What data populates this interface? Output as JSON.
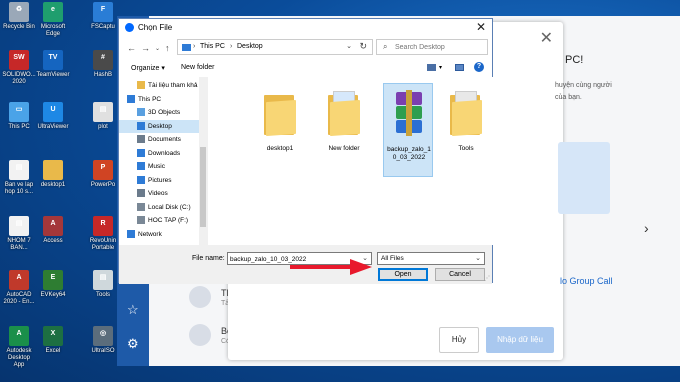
{
  "desktop_icons": [
    {
      "label": "Recycle Bin",
      "color": "#9aa8b8",
      "glyph": "♻"
    },
    {
      "label": "Microsoft Edge",
      "color": "#1f9e6e",
      "glyph": "e"
    },
    {
      "label": "FSCaptu",
      "color": "#2a7dd6",
      "glyph": "F"
    },
    {
      "label": "SOLIDWO... 2020",
      "color": "#c62828",
      "glyph": "SW"
    },
    {
      "label": "TeamViewer",
      "color": "#1565c0",
      "glyph": "TV"
    },
    {
      "label": "HashB",
      "color": "#4a4a4a",
      "glyph": "#"
    },
    {
      "label": "This PC",
      "color": "#4aa3e8",
      "glyph": "▭"
    },
    {
      "label": "UltraViewer",
      "color": "#1e88e5",
      "glyph": "U"
    },
    {
      "label": "plot",
      "color": "#e0e0e0",
      "glyph": "▤"
    },
    {
      "label": "Ban ve lap hop 10 s...",
      "color": "#f2f2f2",
      "glyph": "▤"
    },
    {
      "label": "desktop1",
      "color": "#e9b94a",
      "glyph": ""
    },
    {
      "label": "PowerPo",
      "color": "#d04423",
      "glyph": "P"
    },
    {
      "label": "NHOM 7 BAN...",
      "color": "#f2f2f2",
      "glyph": "▤"
    },
    {
      "label": "Access",
      "color": "#a4373a",
      "glyph": "A"
    },
    {
      "label": "RevoUnin Portable",
      "color": "#c62828",
      "glyph": "R"
    },
    {
      "label": "AutoCAD 2020 - En...",
      "color": "#c0392b",
      "glyph": "A"
    },
    {
      "label": "EVKey64",
      "color": "#2e7d32",
      "glyph": "E"
    },
    {
      "label": "Tools",
      "color": "#cfd8dc",
      "glyph": "▤"
    },
    {
      "label": "Autodesk Desktop App",
      "color": "#1a8f4a",
      "glyph": "A"
    },
    {
      "label": "Excel",
      "color": "#1d6f42",
      "glyph": "X"
    },
    {
      "label": "UltraISO",
      "color": "#5b6d7c",
      "glyph": "◎"
    }
  ],
  "zalo": {
    "rows": [
      {
        "title": "TB - Lớp",
        "sub": "Tấn Dũng"
      },
      {
        "title": "Bộ Y tế",
        "sub": "Có cần đi"
      }
    ],
    "right_texts": {
      "pc": "PC!",
      "desc1": "huyện cùng người",
      "desc2": "của bạn.",
      "group_call": "lo Group Call"
    },
    "cancel_label": "Hủy",
    "import_label": "Nhập dữ liệu"
  },
  "dialog": {
    "title": "Chọn File",
    "address": [
      "This PC",
      "Desktop"
    ],
    "search_placeholder": "Search Desktop",
    "organize_label": "Organize ▾",
    "new_folder_label": "New folder",
    "tree": [
      {
        "label": "Tài liệu tham khả",
        "indent": 1,
        "icon": "folder"
      },
      {
        "label": "This PC",
        "indent": 0,
        "icon": "pc"
      },
      {
        "label": "3D Objects",
        "indent": 1,
        "icon": "3d"
      },
      {
        "label": "Desktop",
        "indent": 1,
        "icon": "desktop",
        "selected": true
      },
      {
        "label": "Documents",
        "indent": 1,
        "icon": "docs"
      },
      {
        "label": "Downloads",
        "indent": 1,
        "icon": "down"
      },
      {
        "label": "Music",
        "indent": 1,
        "icon": "music"
      },
      {
        "label": "Pictures",
        "indent": 1,
        "icon": "pics"
      },
      {
        "label": "Videos",
        "indent": 1,
        "icon": "videos"
      },
      {
        "label": "Local Disk (C:)",
        "indent": 1,
        "icon": "disk"
      },
      {
        "label": "HOC TAP (F:)",
        "indent": 1,
        "icon": "disk"
      },
      {
        "label": "Network",
        "indent": 0,
        "icon": "net"
      }
    ],
    "files": [
      {
        "label": "desktop1",
        "type": "folder"
      },
      {
        "label": "New folder",
        "type": "folder-doc"
      },
      {
        "label": "backup_zalo_10_03_2022",
        "type": "rar",
        "selected": true
      },
      {
        "label": "Tools",
        "type": "folder-tools"
      }
    ],
    "file_name_label": "File name:",
    "file_name_value": "backup_zalo_10_03_2022",
    "file_type_value": "All Files",
    "open_label": "Open",
    "cancel_label": "Cancel"
  },
  "colors": {
    "arrow": "#e8192c",
    "accent": "#0078d7"
  }
}
